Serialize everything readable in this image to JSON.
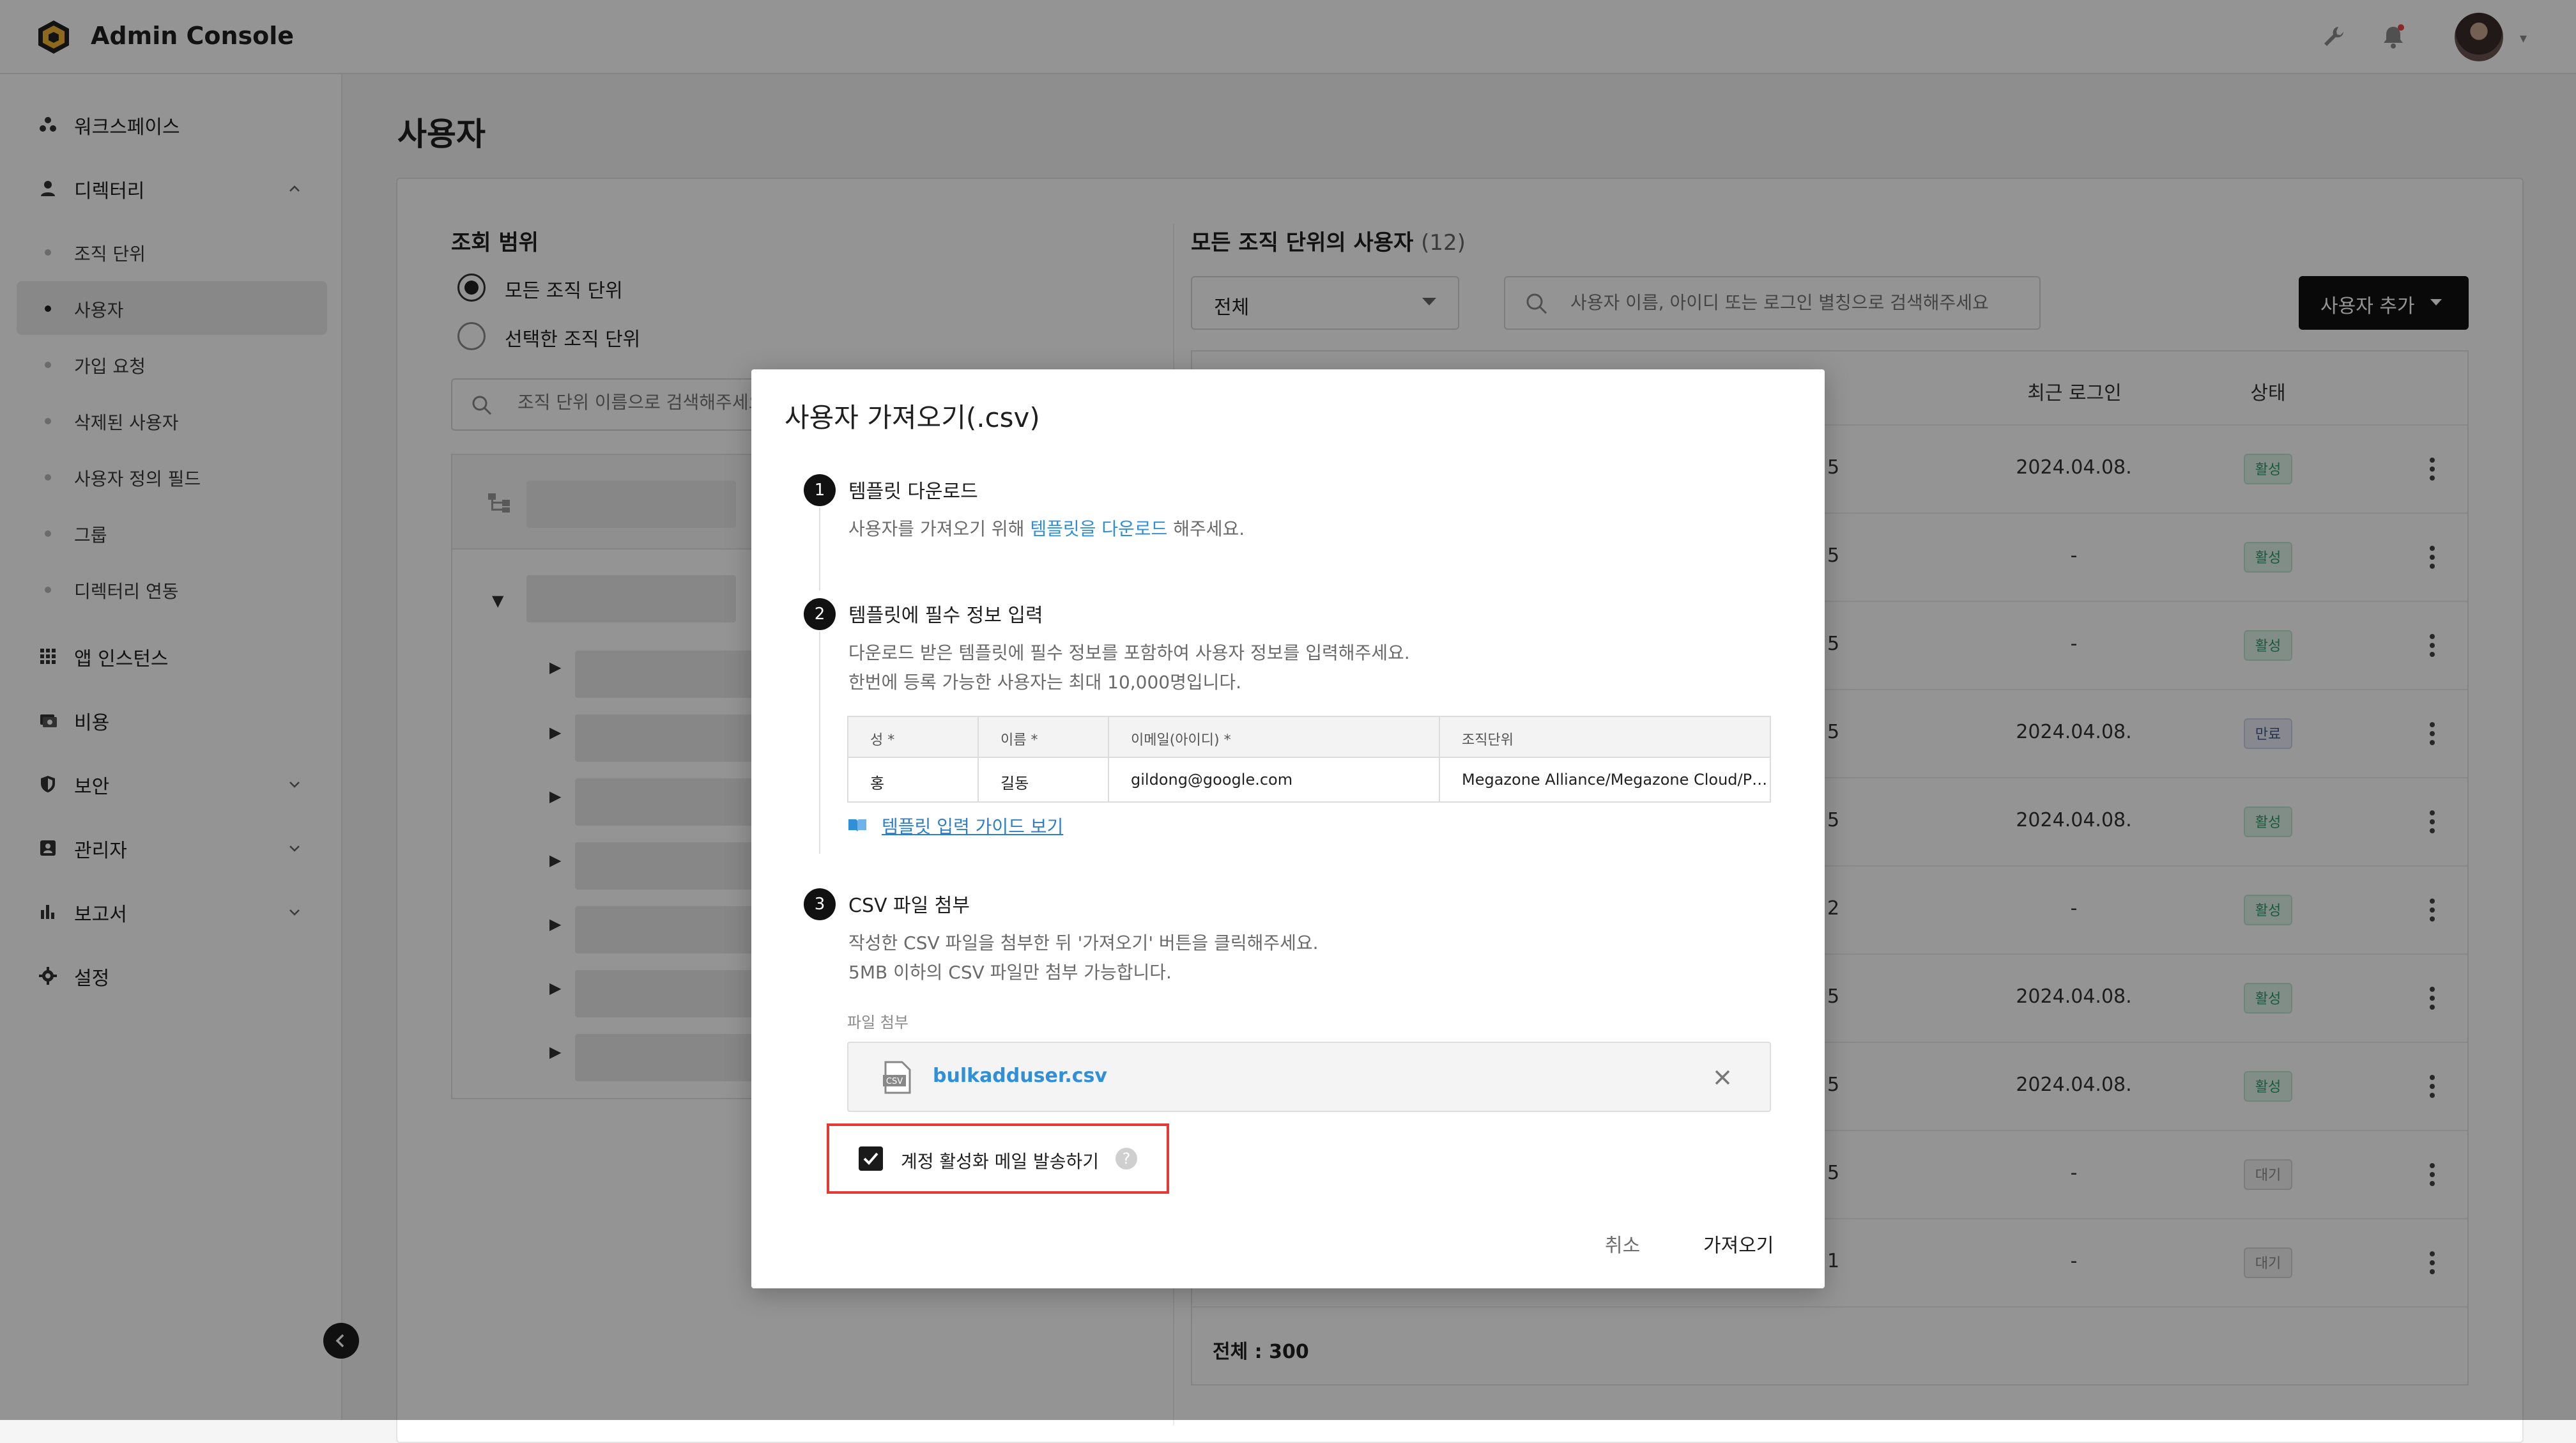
{
  "header": {
    "app_title": "Admin Console",
    "icons": [
      "logo-icon",
      "wrench-icon",
      "bell-icon",
      "avatar",
      "chevron-down-icon"
    ]
  },
  "sidebar": {
    "items": [
      {
        "label": "워크스페이스",
        "icon": "workspace-icon"
      },
      {
        "label": "디렉터리",
        "icon": "person-icon",
        "expanded": true
      },
      {
        "label": "앱 인스턴스",
        "icon": "grid-icon"
      },
      {
        "label": "비용",
        "icon": "billing-icon"
      },
      {
        "label": "보안",
        "icon": "shield-icon"
      },
      {
        "label": "관리자",
        "icon": "admin-icon"
      },
      {
        "label": "보고서",
        "icon": "chart-icon"
      },
      {
        "label": "설정",
        "icon": "gear-icon"
      }
    ],
    "sub_items": [
      {
        "label": "조직 단위"
      },
      {
        "label": "사용자",
        "active": true
      },
      {
        "label": "가입 요청"
      },
      {
        "label": "삭제된 사용자"
      },
      {
        "label": "사용자 정의 필드"
      },
      {
        "label": "그룹"
      },
      {
        "label": "디렉터리 연동"
      }
    ]
  },
  "main": {
    "page_title": "사용자",
    "scope": {
      "title": "조회 범위",
      "options": [
        "모든 조직 단위",
        "선택한 조직 단위"
      ],
      "selected": "모든 조직 단위",
      "search_placeholder": "조직 단위 이름으로 검색해주세요"
    },
    "users": {
      "title": "모든 조직 단위의 사용자",
      "count": "(12)",
      "filter_value": "전체",
      "search_placeholder": "사용자 이름, 아이디 또는 로그인 별칭으로 검색해주세요",
      "add_button": "사용자 추가",
      "columns": {
        "last_login": "최근 로그인",
        "status": "상태"
      },
      "rows": [
        {
          "clip": "5",
          "last_login": "2024.04.08.",
          "status": "활성",
          "kind": "active"
        },
        {
          "clip": "5",
          "last_login": "-",
          "status": "활성",
          "kind": "active"
        },
        {
          "clip": "5",
          "last_login": "-",
          "status": "활성",
          "kind": "active"
        },
        {
          "clip": "5",
          "last_login": "2024.04.08.",
          "status": "만료",
          "kind": "expired"
        },
        {
          "clip": "5",
          "last_login": "2024.04.08.",
          "status": "활성",
          "kind": "active"
        },
        {
          "clip": "2",
          "last_login": "-",
          "status": "활성",
          "kind": "active"
        },
        {
          "clip": "5",
          "last_login": "2024.04.08.",
          "status": "활성",
          "kind": "active"
        },
        {
          "clip": "5",
          "last_login": "2024.04.08.",
          "status": "활성",
          "kind": "active"
        },
        {
          "clip": "5",
          "last_login": "-",
          "status": "대기",
          "kind": "pending"
        },
        {
          "clip": "1",
          "last_login": "-",
          "status": "대기",
          "kind": "pending"
        }
      ],
      "total": "전체 : 300"
    }
  },
  "modal": {
    "title": "사용자 가져오기(.csv)",
    "step1": {
      "num": "1",
      "title": "템플릿 다운로드",
      "desc_before": "사용자를 가져오기 위해 ",
      "desc_link": "템플릿을 다운로드",
      "desc_after": " 해주세요."
    },
    "step2": {
      "num": "2",
      "title": "템플릿에 필수 정보 입력",
      "desc1": "다운로드 받은 템플릿에 필수 정보를 포함하여 사용자 정보를 입력해주세요.",
      "desc2": "한번에 등록 가능한 사용자는 최대 10,000명입니다.",
      "table_headers": [
        "성 *",
        "이름 *",
        "이메일(아이디) *",
        "조직단위"
      ],
      "table_row": [
        "홍",
        "길동",
        "gildong@google.com",
        "Megazone Alliance/Megazone Cloud/P…"
      ],
      "guide_link": "템플릿 입력 가이드 보기"
    },
    "step3": {
      "num": "3",
      "title": "CSV 파일 첨부",
      "desc1": "작성한 CSV 파일을 첨부한 뒤 '가져오기' 버튼을 클릭해주세요.",
      "desc2": "5MB 이하의 CSV 파일만 첨부 가능합니다.",
      "attach_label": "파일 첨부",
      "file_name": "bulkadduser.csv"
    },
    "checkbox_label": "계정 활성화 메일 발송하기",
    "checkbox_checked": true,
    "help_glyph": "?",
    "cancel": "취소",
    "import": "가져오기",
    "highlight_color": "#e53935"
  }
}
